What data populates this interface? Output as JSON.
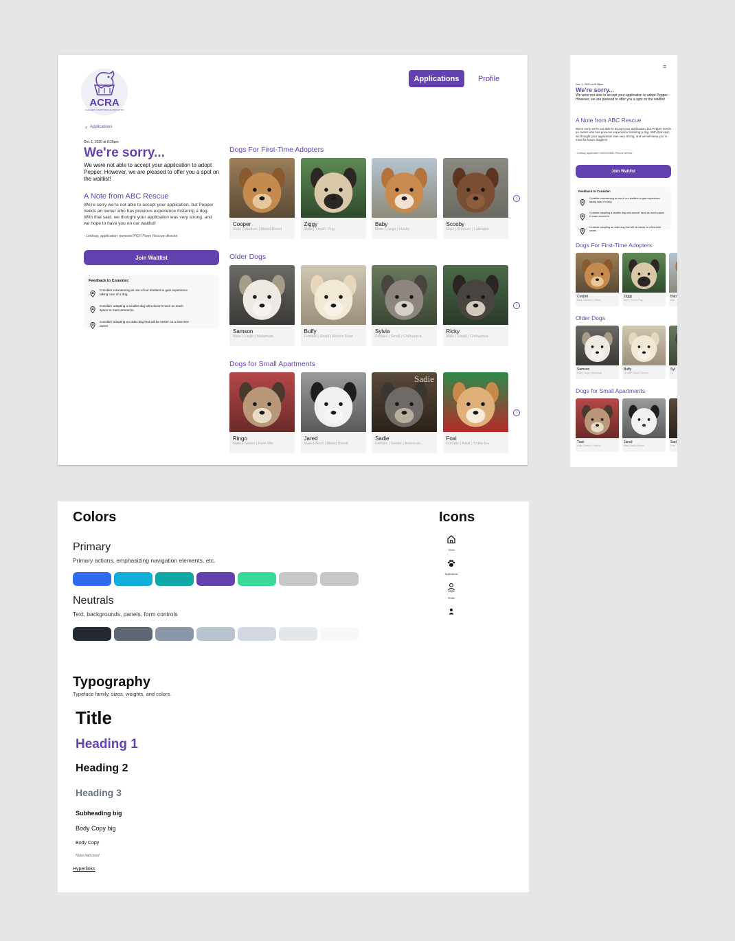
{
  "desktop": {
    "logo": {
      "text": "ACRA",
      "tagline": "ALLEGHENY COUNTY RESCUE ASSOCIATION"
    },
    "nav": {
      "applications": "Applications",
      "profile": "Profile"
    },
    "back_label": "Applications",
    "date": "Dec 1, 2020 at 8:28pm",
    "title": "We're sorry...",
    "message": "We were not able to accept your application to adopt Pepper. However, we are pleased to offer you a spot on the waitlist!",
    "note_title": "A Note from ABC Rescue",
    "note_body": "We're sorry we're not able to accept your application, but Pepper needs an owner who has previous experience fostering a dog. With that said, we thought your application was very strong, and we hope to have you on our waitlist!",
    "note_signature": "- Lindsay, application reviewer/PGH Paws Rescue director",
    "join_label": "Join Waitlist",
    "feedback_title": "Feedback to Consider:",
    "feedback": [
      "Consider volunteering at one of our shelters to gain experience taking care of a dog.",
      "Consider adopting a smaller dog who doesn't need as much space to roam around in.",
      "Consider adopting an older dog that will be easier on a first-time owner"
    ],
    "sections": [
      {
        "title": "Dogs For First-Time Adopters",
        "dogs": [
          {
            "name": "Cooper",
            "desc": "Male | Medium | Mixed Breed",
            "photo": "dog-tan"
          },
          {
            "name": "Ziggy",
            "desc": "Male | Small | Pug",
            "photo": "dog-pug"
          },
          {
            "name": "Baby",
            "desc": "Male | Large | Husky",
            "photo": "dog-shiba"
          },
          {
            "name": "Scooby",
            "desc": "Male | Medium | Labrador",
            "photo": "dog-brown"
          }
        ]
      },
      {
        "title": "Older Dogs",
        "dogs": [
          {
            "name": "Samson",
            "desc": "Male | Large | Malamute",
            "photo": "dog-white"
          },
          {
            "name": "Buffy",
            "desc": "Female | Small | Bichon Frise",
            "photo": "dog-fluffy"
          },
          {
            "name": "Sylvia",
            "desc": "Female | Small | Chihuahua",
            "photo": "dog-grey"
          },
          {
            "name": "Ricky",
            "desc": "Male | Small | Chihuahua",
            "photo": "dog-dark"
          }
        ]
      },
      {
        "title": "Dogs for Small Apartments",
        "dogs": [
          {
            "name": "Ringo",
            "desc": "Male | Senior | Feist Mix",
            "photo": "dog-scarf"
          },
          {
            "name": "Jared",
            "desc": "Male | Adult | Mixed Breed",
            "photo": "dog-bw"
          },
          {
            "name": "Sadie",
            "desc": "Female | Senior | American...",
            "photo": "dog-sadie",
            "overlay": "Sadie"
          },
          {
            "name": "Foxi",
            "desc": "Female | Adult | Shiba Inu",
            "photo": "dog-xmas"
          }
        ]
      }
    ]
  },
  "mobile": {
    "date": "Dec 1, 2020 at 8:28pm",
    "title": "We're sorry...",
    "message": "We were not able to accept your application to adopt Pepper. However, we are pleased to offer you a spot on the waitlist!",
    "note_title": "A Note from ABC Rescue",
    "note_body": "We're sorry we're not able to accept your application, but Pepper needs an owner who has previous experience fostering a dog. With that said, we thought your application was very strong, and we will keep you in mind for future doggies!",
    "note_signature": "- Lindsay, application reviewer/ABC Rescue director",
    "join_label": "Join Waitlist",
    "feedback_title": "Feedback to Consider:",
    "feedback": [
      "Consider volunteering at one of our shelters to gain experience taking care of a dog.",
      "Consider adopting a smaller dog who doesn't need as much space to roam around in.",
      "Consider adopting an older dog that will be easier on a first-time owner"
    ],
    "sections": [
      {
        "title": "Dogs For First-Time Adopters",
        "dogs": [
          {
            "name": "Cooper",
            "desc": "Male | Medium | Mixed",
            "photo": "dog-tan"
          },
          {
            "name": "Ziggy",
            "desc": "Male | Small | Pug",
            "photo": "dog-pug"
          },
          {
            "name": "Bab",
            "desc": "Mal",
            "photo": "dog-shiba"
          }
        ]
      },
      {
        "title": "Older Dogs",
        "dogs": [
          {
            "name": "Samson",
            "desc": "Male | Large | Malamute",
            "photo": "dog-white"
          },
          {
            "name": "Buffy",
            "desc": "Female | Small | Bichon",
            "photo": "dog-fluffy"
          },
          {
            "name": "Syl",
            "desc": "Fe",
            "photo": "dog-grey"
          }
        ]
      },
      {
        "title": "Dogs for Small Apartments",
        "dogs": [
          {
            "name": "Tuck",
            "desc": "Male | Senior | Feist Mi",
            "photo": "dog-scarf"
          },
          {
            "name": "Jared",
            "desc": "Male | Adult | Mixed",
            "photo": "dog-bw"
          },
          {
            "name": "Sad",
            "desc": "Fem",
            "photo": "dog-sadie"
          }
        ]
      }
    ]
  },
  "style": {
    "colors_title": "Colors",
    "primary_title": "Primary",
    "primary_desc": "Primary actions, emphasizing navigation elements, etc.",
    "primary_swatches": [
      "#2f6bef",
      "#10aed8",
      "#0ea9a6",
      "#6342b0",
      "#39d99a",
      "#c7c7c7",
      "#c7c7c7"
    ],
    "neutrals_title": "Neutrals",
    "neutrals_desc": "Text, backgrounds, panels, form controls",
    "neutral_swatches": [
      "#232a34",
      "#5e6874",
      "#8a97a8",
      "#b8c5d0",
      "#d2d8e0",
      "#e3e7ea",
      "#f7f8f9"
    ],
    "icons_title": "Icons",
    "icons": [
      {
        "name": "home-icon",
        "label": "Home"
      },
      {
        "name": "paw-icon",
        "label": "Applications"
      },
      {
        "name": "profile-icon",
        "label": "Profile"
      },
      {
        "name": "person-icon",
        "label": ""
      }
    ],
    "typography_title": "Typography",
    "typography_desc": "Typeface family, sizes, weights, and colors.",
    "samples": {
      "title": "Title",
      "h1": "Heading 1",
      "h2": "Heading 2",
      "h3": "Heading 3",
      "subheading": "Subheading big",
      "body_big": "Body Copy big",
      "body": "Body Copy",
      "note": "Note Italicized",
      "link": "Hyperlinks"
    }
  }
}
